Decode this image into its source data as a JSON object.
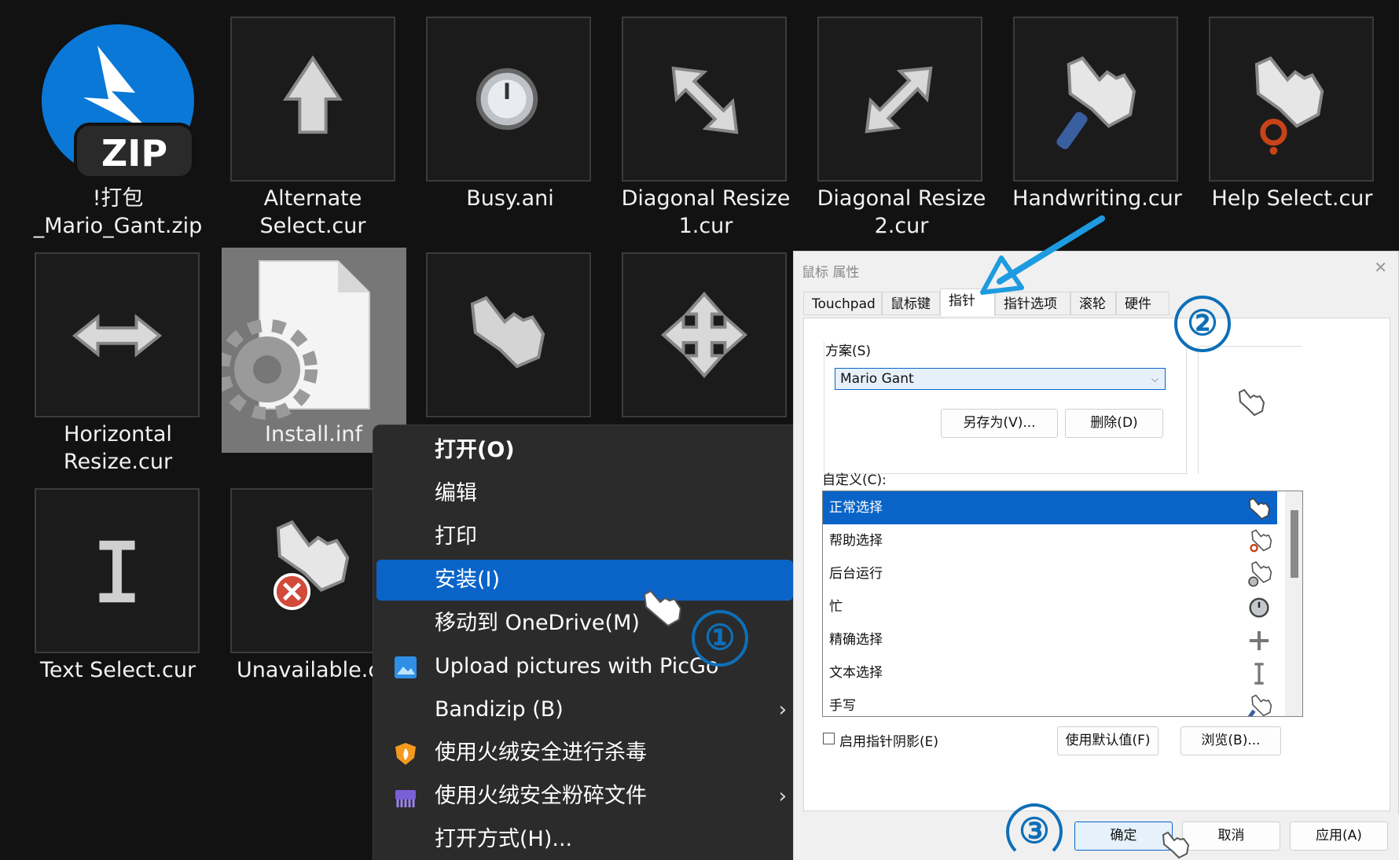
{
  "files": [
    {
      "label": "!打包\n_Mario_Gant.zip",
      "icon": "zip-archive-icon"
    },
    {
      "label": "Alternate\nSelect.cur",
      "icon": "alternate-select-cursor-icon"
    },
    {
      "label": "Busy.ani",
      "icon": "busy-cursor-icon"
    },
    {
      "label": "Diagonal Resize\n1.cur",
      "icon": "diagonal-resize-1-cursor-icon"
    },
    {
      "label": "Diagonal Resize\n2.cur",
      "icon": "diagonal-resize-2-cursor-icon"
    },
    {
      "label": "Handwriting.cur",
      "icon": "handwriting-cursor-icon"
    },
    {
      "label": "Help Select.cur",
      "icon": "help-select-cursor-icon"
    },
    {
      "label": "Horizontal\nResize.cur",
      "icon": "horizontal-resize-cursor-icon"
    },
    {
      "label": "Install.inf",
      "icon": "install-inf-settings-icon"
    },
    {
      "label": "",
      "icon": "link-select-cursor-icon"
    },
    {
      "label": "",
      "icon": "move-cursor-icon"
    },
    {
      "label": "Text Select.cur",
      "icon": "text-select-cursor-icon"
    },
    {
      "label": "Unavailable.c",
      "icon": "unavailable-cursor-icon"
    }
  ],
  "zip_badge": "ZIP",
  "context_menu": {
    "items": [
      {
        "label": "打开(O)",
        "icon": ""
      },
      {
        "label": "编辑",
        "icon": ""
      },
      {
        "label": "打印",
        "icon": ""
      },
      {
        "label": "安装(I)",
        "icon": ""
      },
      {
        "label": "移动到 OneDrive(M)",
        "icon": ""
      },
      {
        "label": "Upload pictures with PicGo",
        "icon": "picgo-icon"
      },
      {
        "label": "Bandizip (B)",
        "icon": "",
        "submenu": true
      },
      {
        "label": "使用火绒安全进行杀毒",
        "icon": "huorong-shield-icon"
      },
      {
        "label": "使用火绒安全粉碎文件",
        "icon": "shredder-icon",
        "submenu": true
      },
      {
        "label": "打开方式(H)...",
        "icon": ""
      }
    ],
    "submenu_arrow": "›"
  },
  "dialog": {
    "title": "鼠标 属性",
    "close": "✕",
    "tabs": [
      "Touchpad",
      "鼠标键",
      "指针",
      "指针选项",
      "滚轮",
      "硬件"
    ],
    "active_tab": "指针",
    "scheme_label": "方案(S)",
    "scheme_value": "Mario Gant",
    "combo_arrow": "⌵",
    "save_as": "另存为(V)...",
    "delete": "删除(D)",
    "customize_label": "自定义(C):",
    "pointers": [
      {
        "name": "正常选择",
        "icon": "hand-pointer-icon"
      },
      {
        "name": "帮助选择",
        "icon": "help-hand-icon"
      },
      {
        "name": "后台运行",
        "icon": "working-hand-icon"
      },
      {
        "name": "忙",
        "icon": "busy-clock-icon"
      },
      {
        "name": "精确选择",
        "icon": "crosshair-icon"
      },
      {
        "name": "文本选择",
        "icon": "ibeam-icon"
      },
      {
        "name": "手写",
        "icon": "handwriting-hand-icon"
      }
    ],
    "shadow_checkbox": "启用指针阴影(E)",
    "use_default": "使用默认值(F)",
    "browse": "浏览(B)...",
    "ok": "确定",
    "cancel": "取消",
    "apply": "应用(A)"
  },
  "annotations": [
    "①",
    "②",
    "③"
  ],
  "colors": {
    "accent": "#0A64C8",
    "annotation_blue": "#0D6FB8",
    "arrow_blue": "#1E9BE0",
    "background": "#121212"
  }
}
